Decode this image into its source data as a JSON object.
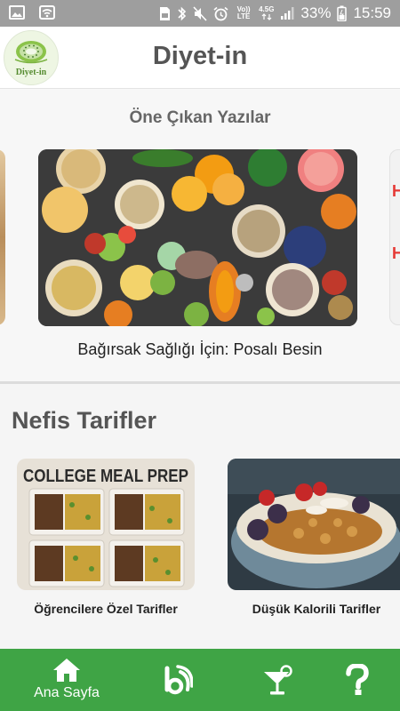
{
  "status_bar": {
    "network_label_top": "Vo)) LTE",
    "network_label_gen": "4.5G",
    "battery_percent": "33%",
    "time": "15:59"
  },
  "header": {
    "logo_text": "Diyet-in",
    "title": "Diyet-in"
  },
  "featured": {
    "section_title": "Öne Çıkan Yazılar",
    "card_title": "Bağırsak Sağlığı İçin: Posalı Besin",
    "right_peek_letters": [
      "H",
      "H"
    ]
  },
  "recipes": {
    "section_title": "Nefis Tarifler",
    "items": [
      {
        "image_text": "COLLEGE MEAL PREP",
        "caption": "Öğrencilere Özel Tarifler"
      },
      {
        "caption": "Düşük Kalorili Tarifler"
      }
    ]
  },
  "bottom_nav": {
    "items": [
      {
        "label": "Ana Sayfa",
        "icon": "home-icon"
      },
      {
        "icon": "feed-icon"
      },
      {
        "icon": "cocktail-icon"
      },
      {
        "icon": "help-icon"
      }
    ]
  },
  "colors": {
    "status_bar": "#9e9e9e",
    "nav_green": "#3fa445",
    "title_gray": "#555555"
  }
}
